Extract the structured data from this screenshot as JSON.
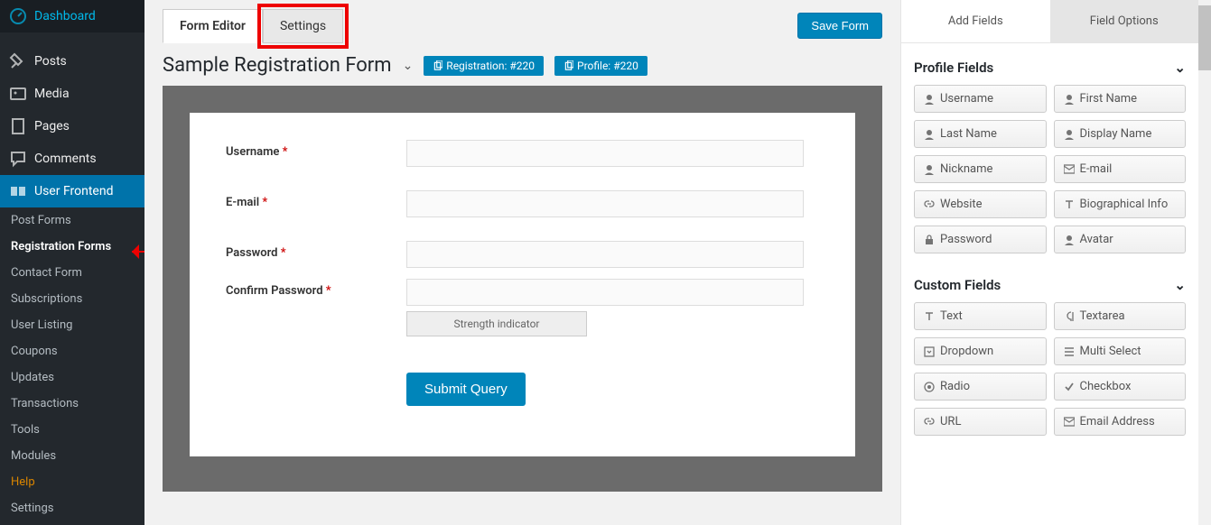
{
  "sidebar": {
    "top": [
      {
        "icon": "dashboard",
        "label": "Dashboard"
      },
      {
        "icon": "pin",
        "label": "Posts"
      },
      {
        "icon": "media",
        "label": "Media"
      },
      {
        "icon": "page",
        "label": "Pages"
      },
      {
        "icon": "comment",
        "label": "Comments"
      },
      {
        "icon": "uf",
        "label": "User Frontend"
      }
    ],
    "sub": [
      {
        "label": "Post Forms"
      },
      {
        "label": "Registration Forms",
        "current": true
      },
      {
        "label": "Contact Form"
      },
      {
        "label": "Subscriptions"
      },
      {
        "label": "User Listing"
      },
      {
        "label": "Coupons"
      },
      {
        "label": "Updates"
      },
      {
        "label": "Transactions"
      },
      {
        "label": "Tools"
      },
      {
        "label": "Modules"
      },
      {
        "label": "Help",
        "help": true
      },
      {
        "label": "Settings"
      }
    ]
  },
  "tabs": {
    "form_editor": "Form Editor",
    "settings": "Settings"
  },
  "save_button": "Save Form",
  "form_title": "Sample Registration Form",
  "pills": {
    "registration": "Registration: #220",
    "profile": "Profile: #220"
  },
  "fields": {
    "username": {
      "label": "Username"
    },
    "email": {
      "label": "E-mail"
    },
    "password": {
      "label": "Password"
    },
    "confirm": {
      "label": "Confirm Password"
    },
    "strength": "Strength indicator",
    "submit": "Submit Query"
  },
  "right_panel": {
    "tabs": {
      "add_fields": "Add Fields",
      "field_options": "Field Options"
    },
    "sections": {
      "profile": "Profile Fields",
      "custom": "Custom Fields"
    },
    "profile_fields": [
      {
        "icon": "user",
        "label": "Username"
      },
      {
        "icon": "user",
        "label": "First Name"
      },
      {
        "icon": "user",
        "label": "Last Name"
      },
      {
        "icon": "user",
        "label": "Display Name"
      },
      {
        "icon": "user",
        "label": "Nickname"
      },
      {
        "icon": "mail",
        "label": "E-mail"
      },
      {
        "icon": "link",
        "label": "Website"
      },
      {
        "icon": "text",
        "label": "Biographical Info"
      },
      {
        "icon": "lock",
        "label": "Password"
      },
      {
        "icon": "user",
        "label": "Avatar"
      }
    ],
    "custom_fields": [
      {
        "icon": "text",
        "label": "Text"
      },
      {
        "icon": "para",
        "label": "Textarea"
      },
      {
        "icon": "dd",
        "label": "Dropdown"
      },
      {
        "icon": "list",
        "label": "Multi Select"
      },
      {
        "icon": "radio",
        "label": "Radio"
      },
      {
        "icon": "check",
        "label": "Checkbox"
      },
      {
        "icon": "link",
        "label": "URL"
      },
      {
        "icon": "mail",
        "label": "Email Address"
      }
    ]
  }
}
